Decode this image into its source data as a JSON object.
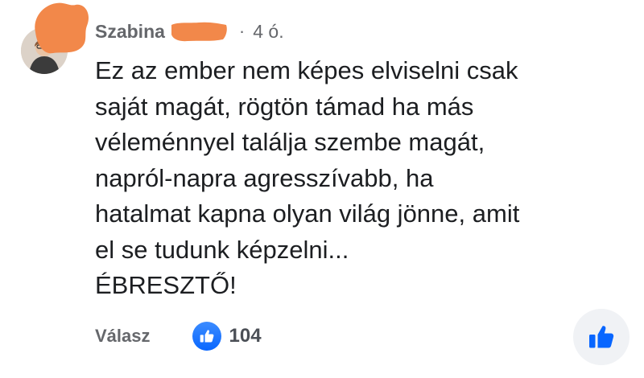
{
  "comment": {
    "author": "Szabina",
    "separator": "·",
    "time": "4 ó.",
    "lines": [
      "Ez az ember nem képes elviselni csak",
      "saját magát, rögtön támad ha más",
      "véleménnyel találja szembe magát,",
      "napról-napra agresszívabb, ha",
      "hatalmat kapna olyan világ jönne, amit",
      "el se tudunk képzelni...",
      "ÉBRESZTŐ!"
    ],
    "reply_label": "Válasz",
    "reaction_count": "104",
    "reaction_icon": "like-icon",
    "like_button_icon": "thumbs-up-icon"
  },
  "colors": {
    "like_blue": "#0866ff",
    "meta_gray": "#65676b",
    "redaction_orange": "#f2884a",
    "like_button_bg": "#f0f2f5"
  }
}
